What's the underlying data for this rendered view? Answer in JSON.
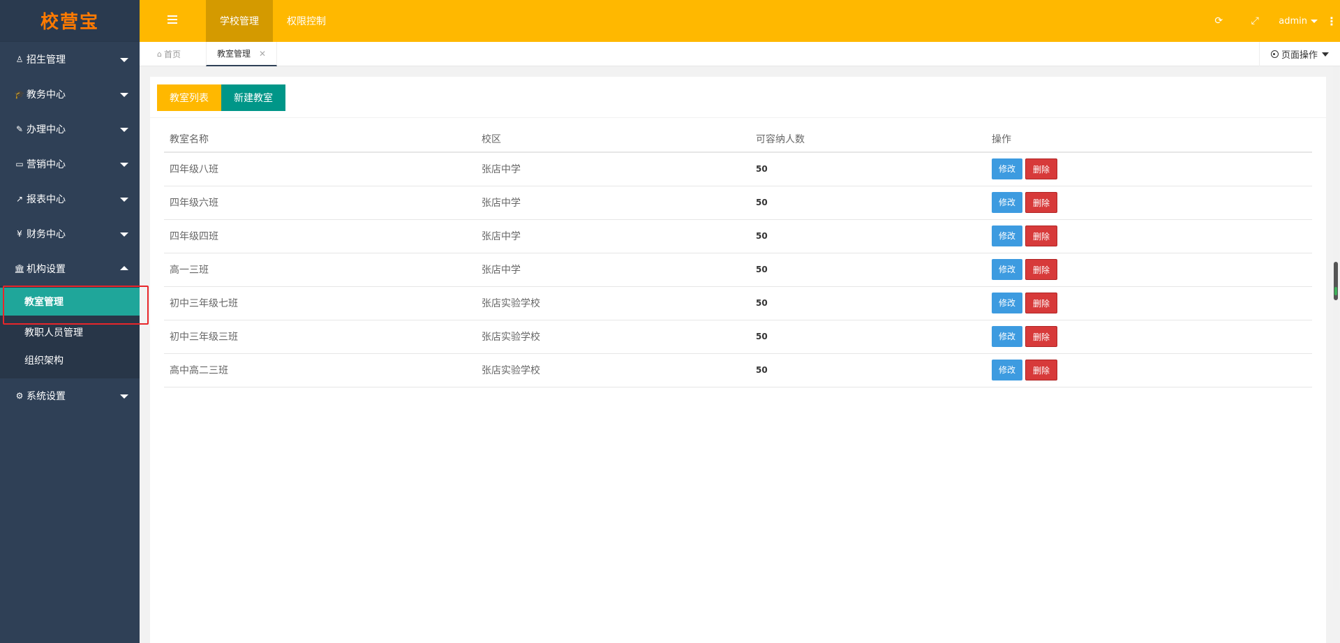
{
  "app": {
    "logo": "校营宝"
  },
  "header": {
    "nav": [
      {
        "label": "学校管理",
        "active": true
      },
      {
        "label": "权限控制",
        "active": false
      }
    ],
    "user": "admin"
  },
  "sidebar": {
    "items": [
      {
        "label": "招生管理",
        "icon": "user-icon",
        "glyph": "♙"
      },
      {
        "label": "教务中心",
        "icon": "graduation-cap-icon",
        "glyph": "🎓"
      },
      {
        "label": "办理中心",
        "icon": "edit-icon",
        "glyph": "✎"
      },
      {
        "label": "营销中心",
        "icon": "laptop-icon",
        "glyph": "▭"
      },
      {
        "label": "报表中心",
        "icon": "line-chart-icon",
        "glyph": "↗"
      },
      {
        "label": "财务中心",
        "icon": "yen-icon",
        "glyph": "¥"
      },
      {
        "label": "机构设置",
        "icon": "institution-icon",
        "glyph": "🏛",
        "expanded": true
      },
      {
        "label": "系统设置",
        "icon": "cogs-icon",
        "glyph": "⚙"
      }
    ],
    "sub_items": [
      {
        "label": "教室管理",
        "active": true
      },
      {
        "label": "教职人员管理"
      },
      {
        "label": "组织架构"
      }
    ]
  },
  "tabs": {
    "home": "首页",
    "current": "教室管理",
    "page_ops": "页面操作"
  },
  "content": {
    "btn_list": "教室列表",
    "btn_new": "新建教室",
    "table": {
      "headers": [
        "教室名称",
        "校区",
        "可容纳人数",
        "操作"
      ],
      "rows": [
        {
          "name": "四年级八班",
          "campus": "张店中学",
          "capacity": "50"
        },
        {
          "name": "四年级六班",
          "campus": "张店中学",
          "capacity": "50"
        },
        {
          "name": "四年级四班",
          "campus": "张店中学",
          "capacity": "50"
        },
        {
          "name": "高一三班",
          "campus": "张店中学",
          "capacity": "50"
        },
        {
          "name": "初中三年级七班",
          "campus": "张店实验学校",
          "capacity": "50"
        },
        {
          "name": "初中三年级三班",
          "campus": "张店实验学校",
          "capacity": "50"
        },
        {
          "name": "高中高二三班",
          "campus": "张店实验学校",
          "capacity": "50"
        }
      ],
      "edit_label": "修改",
      "delete_label": "删除"
    }
  },
  "colors": {
    "header": "#ffb800",
    "sidebar": "#2f4056",
    "active_sub": "#1fa69a",
    "edit": "#3d9be0",
    "delete": "#d73a3a"
  }
}
